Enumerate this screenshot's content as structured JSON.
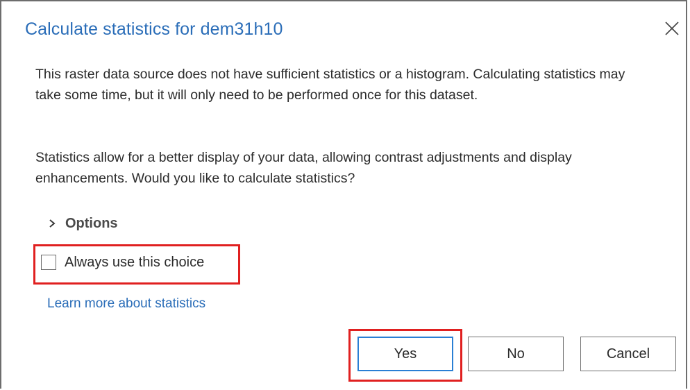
{
  "dialog": {
    "title": "Calculate statistics for dem31h10",
    "message_1": "This raster data source does not have sufficient statistics or a histogram. Calculating statistics may take some time, but it will only need to be performed once for this dataset.",
    "message_2": "Statistics allow for a better display of your data, allowing contrast adjustments and display enhancements. Would you like to calculate statistics?",
    "options_label": "Options",
    "checkbox_label": "Always use this choice",
    "checkbox_checked": false,
    "link_text": "Learn more about statistics",
    "buttons": {
      "yes": "Yes",
      "no": "No",
      "cancel": "Cancel"
    }
  },
  "colors": {
    "title": "#2a6db8",
    "link": "#2a6db8",
    "highlight": "#e02020",
    "default_button_border": "#2a7fd4"
  },
  "icons": {
    "close": "close-icon",
    "options": "chevron-right-icon"
  }
}
